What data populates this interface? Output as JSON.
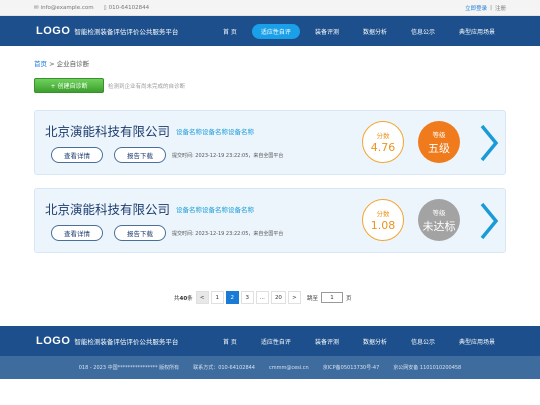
{
  "topbar": {
    "email": "info@example.com",
    "phone": "010-64102844",
    "login": "立即登录",
    "sep": "|",
    "register": "注册"
  },
  "header": {
    "logo": "LOGO",
    "site_name": "智能检测装备评估评价公共服务平台",
    "menu": [
      "首 页",
      "适应性自评",
      "装备评测",
      "数据分析",
      "信息公示",
      "典型应用场景"
    ]
  },
  "breadcrumb": {
    "home": "首页",
    "sep": ">",
    "current": "企业自诊断"
  },
  "action": {
    "button": "+ 创建自诊断",
    "hint": "检测到企业有尚未完成的自诊断"
  },
  "cards": [
    {
      "company": "北京演能科技有限公司",
      "equipment": "设备名称设备名称设备名称",
      "detail_label": "查看详情",
      "report_label": "报告下载",
      "submit": "提交时间: 2023-12-19 23:22:05，来自全国平台",
      "score_label": "分数",
      "score": "4.76",
      "grade_label": "等级",
      "grade": "五级"
    },
    {
      "company": "北京演能科技有限公司",
      "equipment": "设备名称设备名称设备名称",
      "detail_label": "查看详情",
      "report_label": "报告下载",
      "submit": "提交时间: 2023-12-19 23:22:05，来自全国平台",
      "score_label": "分数",
      "score": "1.08",
      "grade_label": "等级",
      "grade": "未达标"
    }
  ],
  "pagination": {
    "total_prefix": "共",
    "total": "40",
    "total_suffix": "条",
    "prev": "<",
    "pages": [
      "1",
      "2",
      "3",
      "...",
      "20"
    ],
    "next": ">",
    "jump_prefix": "跳至",
    "jump_value": "1",
    "jump_suffix": "页"
  },
  "footer": {
    "logo": "LOGO",
    "site_name": "智能检测装备评估评价公共服务平台",
    "menu": [
      "首 页",
      "适应性自评",
      "装备评测",
      "数据分析",
      "信息公示",
      "典型应用场景"
    ],
    "copyright": "018 - 2023 中国**************** 版权所有",
    "contact": "联系方式：010-64102844",
    "email": "cmmm@cesi.cn",
    "icp": "京ICP备05013730号-47",
    "police": "京公网安备 1101010200458"
  },
  "colors": {
    "nav": "#1c4f8c",
    "accent": "#1aa0e8",
    "score": "#f3a531",
    "grade_high": "#f07b1d",
    "grade_fail": "#a3a3a3"
  }
}
